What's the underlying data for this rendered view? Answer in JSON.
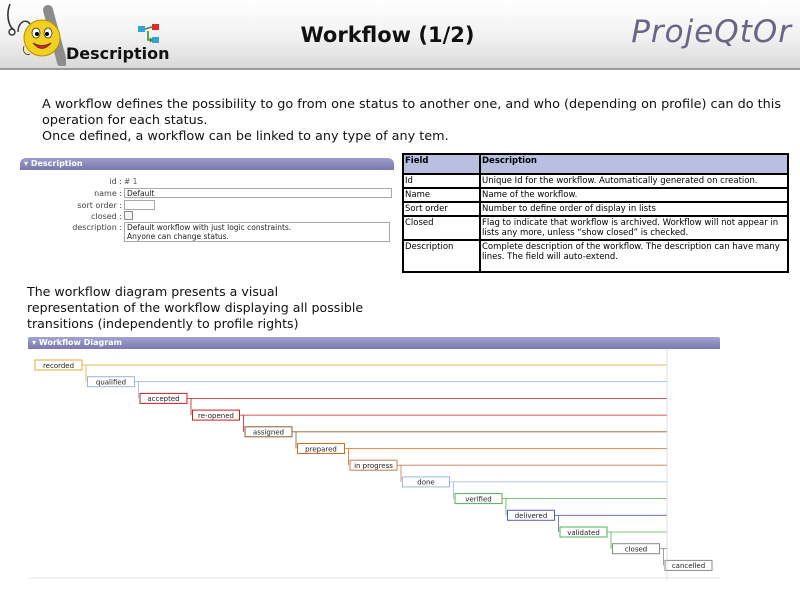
{
  "header": {
    "section_label": "Description",
    "title": "Workflow (1/2)",
    "brand": "ProjeQtOr"
  },
  "intro": {
    "line1": "A workflow defines the possibility to go from one status to another one, and who (depending on profile) can do this operation for each status.",
    "line2": "Once defined, a workflow can be linked to any type of any tem."
  },
  "description_panel": {
    "title": "Description",
    "fields": {
      "id_label": "id :",
      "id_value": "# 1",
      "name_label": "name :",
      "name_value": "Default",
      "sort_order_label": "sort order :",
      "sort_order_value": "",
      "closed_label": "closed :",
      "description_label": "description :",
      "description_line1": "Default workflow with just logic constraints.",
      "description_line2": "Anyone can change status."
    }
  },
  "field_table": {
    "headers": [
      "Field",
      "Description"
    ],
    "rows": [
      {
        "field": "Id",
        "description": "Unique Id for the workflow. Automatically generated on creation."
      },
      {
        "field": "Name",
        "description": "Name of the workflow."
      },
      {
        "field": "Sort order",
        "description": "Number to define order of display in lists"
      },
      {
        "field": "Closed",
        "description": "Flag to indicate that workflow is archived. Workflow will not appear in lists any more, unless “show closed” is checked."
      },
      {
        "field": "Description",
        "description": "Complete description of the workflow. The description can have many lines. The field will auto-extend."
      }
    ]
  },
  "diagram_text": {
    "line1": "The workflow diagram presents a visual",
    "line2": "representation of the workflow displaying all possible",
    "line3": "transitions (independently to profile rights)"
  },
  "workflow_diagram": {
    "title": "Workflow Diagram",
    "statuses": [
      {
        "label": "recorded",
        "color": "#e8a92c"
      },
      {
        "label": "qualified",
        "color": "#9ab6e0"
      },
      {
        "label": "accepted",
        "color": "#c81e1e"
      },
      {
        "label": "re-opened",
        "color": "#c81e1e"
      },
      {
        "label": "assigned",
        "color": "#8a5a2a"
      },
      {
        "label": "prepared",
        "color": "#d86a1c"
      },
      {
        "label": "in progress",
        "color": "#c87a50"
      },
      {
        "label": "done",
        "color": "#9ab6e0"
      },
      {
        "label": "verified",
        "color": "#54b054"
      },
      {
        "label": "delivered",
        "color": "#5a5ab8"
      },
      {
        "label": "validated",
        "color": "#54b054"
      },
      {
        "label": "closed",
        "color": "#888888"
      },
      {
        "label": "cancelled",
        "color": "#888888"
      }
    ]
  },
  "colors": {
    "panel_header": "#8a8abf",
    "table_header": "#b8bfe0",
    "brand_text": "#6b6585"
  }
}
